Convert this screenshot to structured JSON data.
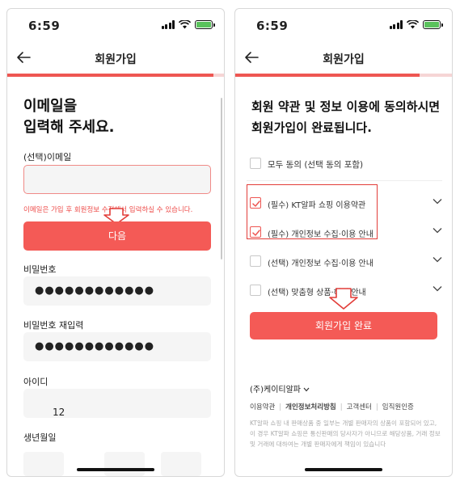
{
  "left_screen": {
    "status": {
      "time": "6:59"
    },
    "header": {
      "title": "회원가입"
    },
    "progress": 0.95,
    "heading_line1": "이메일을",
    "heading_line2": "입력해 주세요.",
    "email": {
      "label": "(선택)이메일",
      "value": "",
      "error": "이메일은 가입 후 회원정보 수정에서 입력하실 수 있습니다."
    },
    "next_button": "다음",
    "password": {
      "label": "비밀번호",
      "value": "●●●●●●●●●●●●"
    },
    "password_confirm": {
      "label": "비밀번호 재입력",
      "value": "●●●●●●●●●●●●"
    },
    "user_id": {
      "label": "아이디",
      "value": "12"
    },
    "birth": {
      "label": "생년월일"
    }
  },
  "right_screen": {
    "status": {
      "time": "6:59"
    },
    "header": {
      "title": "회원가입"
    },
    "progress": 0.85,
    "heading_line1": "회원 약관 및 정보 이용에 동의하시면",
    "heading_line2": "회원가입이 완료됩니다.",
    "agree_all": "모두 동의 (선택 동의 포함)",
    "terms": [
      {
        "label": "(필수) KT알파 쇼핑 이용약관",
        "checked": true
      },
      {
        "label": "(필수) 개인정보 수집·이용 안내",
        "checked": true
      },
      {
        "label": "(선택) 개인정보 수집·이용 안내",
        "checked": false
      },
      {
        "label": "(선택) 맞춤형 상품·혜택 안내",
        "checked": false
      }
    ],
    "complete_button": "회원가입 완료",
    "company": "(주)케이티알파",
    "footer_links": [
      "이용약관",
      "개인정보처리방침",
      "고객센터",
      "임직원인증"
    ],
    "disclaimer": "KT알파 쇼핑 내 판매상품 중 일부는 개별 판매자의 상품이 포함되어 있고, 이 경우 KT알파 쇼핑은 통신판매의 당사자가 아니므로 해당상품, 거래 정보 및 거래에 대하여는 개별 판매자에게 책임이 있습니다"
  },
  "colors": {
    "accent": "#f45a56",
    "error": "#ee4c4a",
    "highlight_box": "#e23d39",
    "battery": "#5ac25c"
  },
  "icons": [
    "back-arrow-icon",
    "signal-icon",
    "wifi-icon",
    "battery-icon",
    "checkmark-icon",
    "chevron-down-icon",
    "down-arrow-icon"
  ]
}
